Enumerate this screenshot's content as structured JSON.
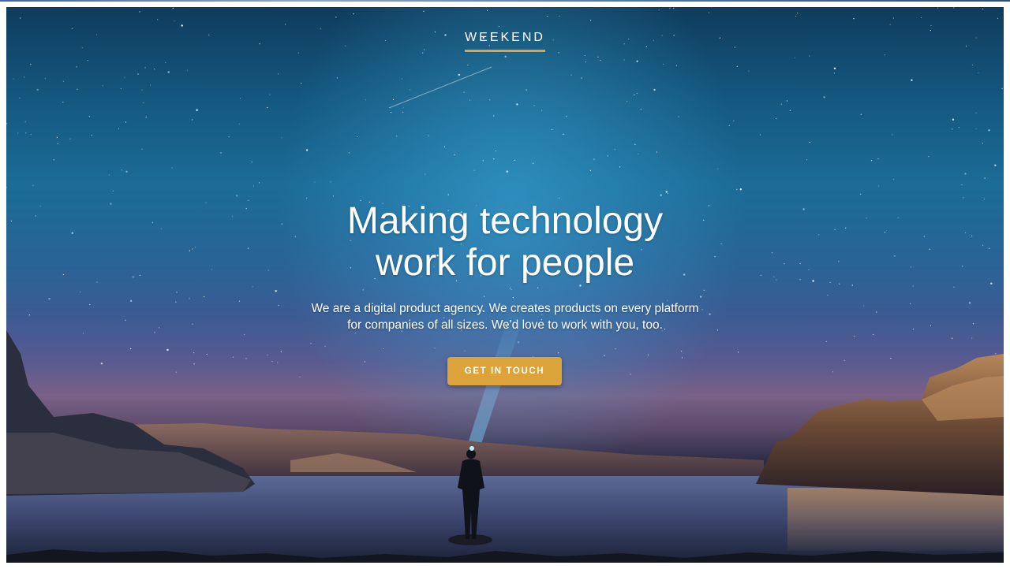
{
  "brand": {
    "name": "WEEKEND"
  },
  "hero": {
    "headline_line1": "Making technology",
    "headline_line2": "work for people",
    "sub_line1": "We are a digital product agency. We creates products on every platform",
    "sub_line2": "for companies of all sizes. We'd love to work with you, too.",
    "cta_label": "GET IN TOUCH"
  },
  "colors": {
    "accent": "#dba33a",
    "text": "#ffffff"
  }
}
